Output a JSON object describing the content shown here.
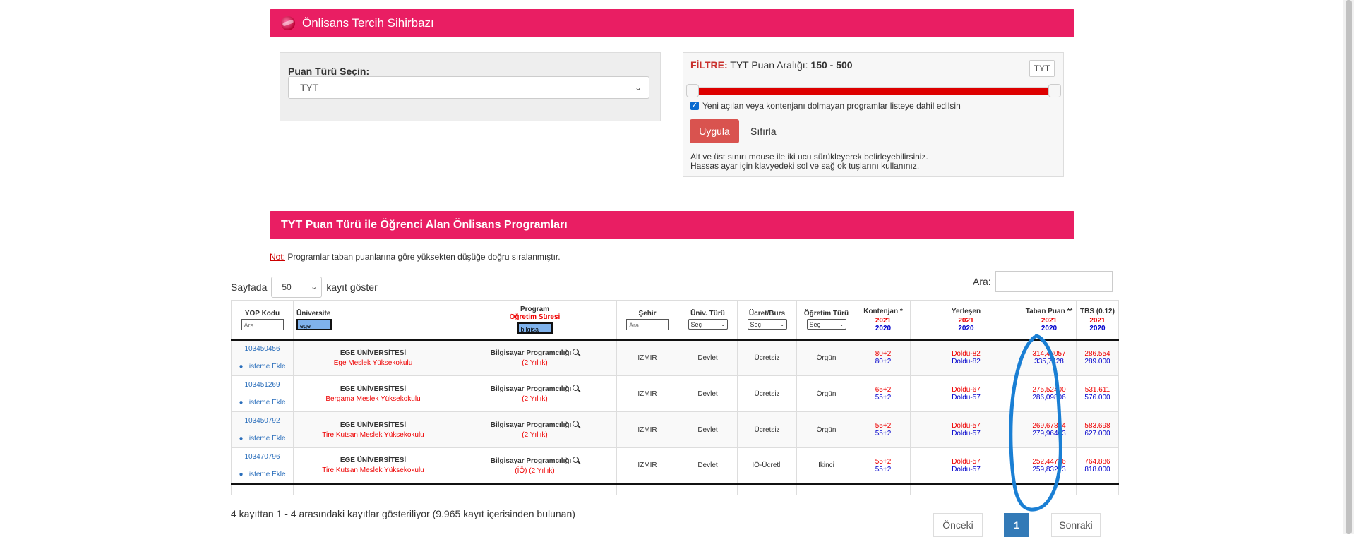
{
  "wizard": {
    "title": "Önlisans Tercih Sihirbazı"
  },
  "puan_turu": {
    "label": "Puan Türü Seçin:",
    "selected": "TYT"
  },
  "filter": {
    "prefix": "FİLTRE:",
    "range_text": "TYT Puan Aralığı:",
    "range_value": "150 - 500",
    "tyt_button": "TYT",
    "checkbox_label": "Yeni açılan veya kontenjanı dolmayan programlar listeye dahil edilsin",
    "checkbox_checked": true,
    "apply_label": "Uygula",
    "reset_label": "Sıfırla",
    "help_line1": "Alt ve üst sınırı mouse ile iki ucu sürükleyerek belirleyebilirsiniz.",
    "help_line2": "Hassas ayar için klavyedeki sol ve sağ ok tuşlarını kullanınız."
  },
  "section": {
    "title": "TYT Puan Türü ile Öğrenci Alan Önlisans Programları"
  },
  "note": {
    "label": "Not:",
    "text": " Programlar taban puanlarına göre yüksekten düşüğe doğru sıralanmıştır."
  },
  "length": {
    "prefix": "Sayfada",
    "value": "50",
    "suffix": "kayıt göster"
  },
  "search": {
    "label": "Ara:",
    "value": ""
  },
  "headers": {
    "yop": "YOP Kodu",
    "yop_filter_placeholder": "Ara",
    "universite": "Üniversite",
    "universite_filter": "ege",
    "program": "Program",
    "program_sub": "Öğretim Süresi",
    "program_filter": "bilgisa",
    "sehir": "Şehir",
    "sehir_filter_placeholder": "Ara",
    "univ_turu": "Üniv. Türü",
    "univ_turu_select": "Seç",
    "ucret": "Ücret/Burs",
    "ucret_select": "Seç",
    "ogretim": "Öğretim Türü",
    "ogretim_select": "Seç",
    "kontenjan": "Kontenjan *",
    "yerlesen": "Yerleşen",
    "taban": "Taban Puan **",
    "tbs": "TBS (0.12)",
    "y1": "2021",
    "y2": "2020"
  },
  "rows": [
    {
      "kod": "103450456",
      "ekle": "Listeme Ekle",
      "uni": "EGE ÜNİVERSİTESİ",
      "fakulte": "Ege Meslek Yüksekokulu",
      "program": "Bilgisayar Programcılığı",
      "sure": "(2 Yıllık)",
      "sehir": "İZMİR",
      "tur": "Devlet",
      "ucret": "Ücretsiz",
      "ogretim": "Örgün",
      "kont_21": "80+2",
      "kont_20": "80+2",
      "yer_21": "Doldu-82",
      "yer_20": "Doldu-82",
      "taban_21": "314,43057",
      "taban_20": "335,7428",
      "tbs_21": "286.554",
      "tbs_20": "289.000"
    },
    {
      "kod": "103451269",
      "ekle": "Listeme Ekle",
      "uni": "EGE ÜNİVERSİTESİ",
      "fakulte": "Bergama Meslek Yüksekokulu",
      "program": "Bilgisayar Programcılığı",
      "sure": "(2 Yıllık)",
      "sehir": "İZMİR",
      "tur": "Devlet",
      "ucret": "Ücretsiz",
      "ogretim": "Örgün",
      "kont_21": "65+2",
      "kont_20": "55+2",
      "yer_21": "Doldu-67",
      "yer_20": "Doldu-57",
      "taban_21": "275,52400",
      "taban_20": "286,09806",
      "tbs_21": "531.611",
      "tbs_20": "576.000"
    },
    {
      "kod": "103450792",
      "ekle": "Listeme Ekle",
      "uni": "EGE ÜNİVERSİTESİ",
      "fakulte": "Tire Kutsan Meslek Yüksekokulu",
      "program": "Bilgisayar Programcılığı",
      "sure": "(2 Yıllık)",
      "sehir": "İZMİR",
      "tur": "Devlet",
      "ucret": "Ücretsiz",
      "ogretim": "Örgün",
      "kont_21": "55+2",
      "kont_20": "55+2",
      "yer_21": "Doldu-57",
      "yer_20": "Doldu-57",
      "taban_21": "269,67834",
      "taban_20": "279,96403",
      "tbs_21": "583.698",
      "tbs_20": "627.000"
    },
    {
      "kod": "103470796",
      "ekle": "Listeme Ekle",
      "uni": "EGE ÜNİVERSİTESİ",
      "fakulte": "Tire Kutsan Meslek Yüksekokulu",
      "program": "Bilgisayar Programcılığı",
      "sure": "(İÖ) (2 Yıllık)",
      "sehir": "İZMİR",
      "tur": "Devlet",
      "ucret": "İÖ-Ücretli",
      "ogretim": "İkinci",
      "kont_21": "55+2",
      "kont_20": "55+2",
      "yer_21": "Doldu-57",
      "yer_20": "Doldu-57",
      "taban_21": "252,44726",
      "taban_20": "259,83223",
      "tbs_21": "764.886",
      "tbs_20": "818.000"
    }
  ],
  "info": "4 kayıttan 1 - 4 arasındaki kayıtlar gösteriliyor (9.965 kayıt içerisinden bulunan)",
  "pagination": {
    "prev": "Önceki",
    "current": "1",
    "next": "Sonraki"
  },
  "colors": {
    "banner": "#e91e63",
    "annotation": "#1a7fd4",
    "apply": "#d9534f",
    "page_active": "#337ab7"
  }
}
